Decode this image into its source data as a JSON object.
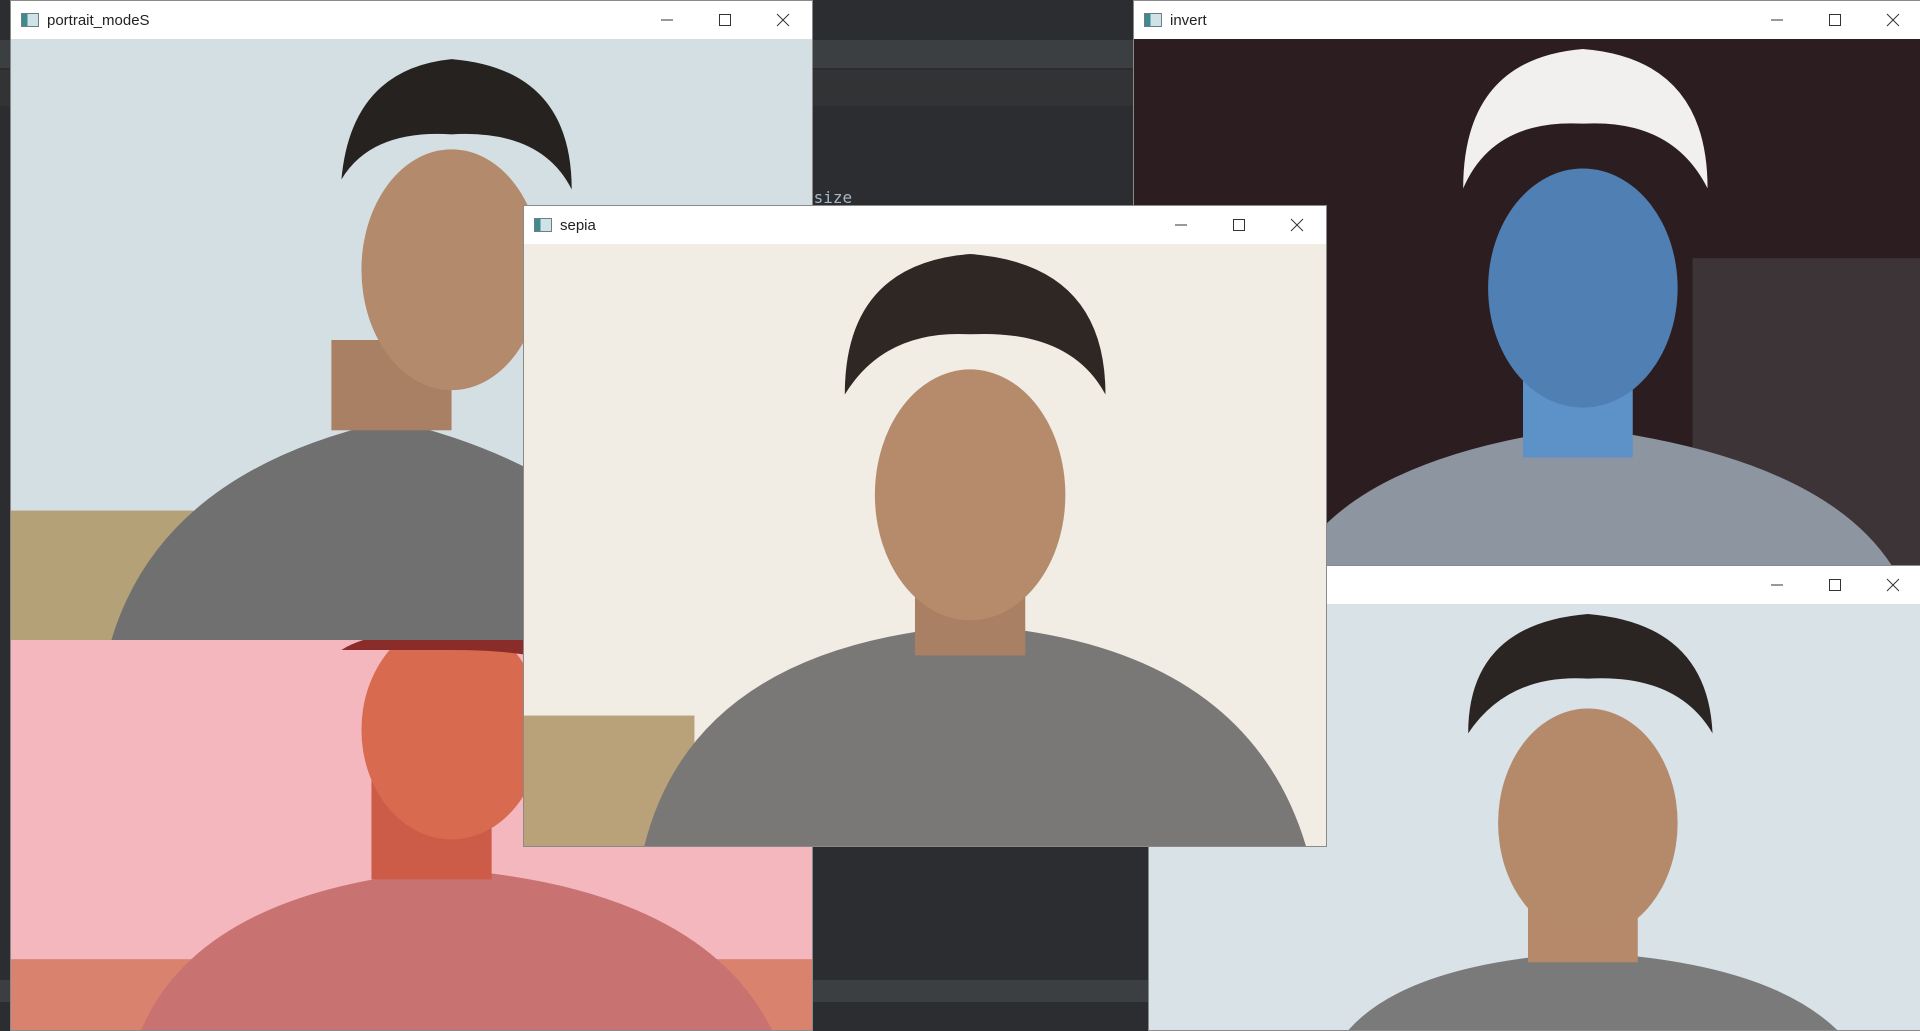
{
  "ide": {
    "code_fragment": "esize"
  },
  "windows": {
    "portrait": {
      "title": "portrait_modeS",
      "icon": "opencv-window-icon"
    },
    "invert": {
      "title": "invert",
      "icon": "opencv-window-icon"
    },
    "sepia": {
      "title": "sepia",
      "icon": "opencv-window-icon"
    },
    "blur_br": {
      "title": ""
    },
    "red_tint": {
      "title": ""
    }
  },
  "colors": {
    "sepia_bg": "#f1ece4",
    "portrait_bg": "#d7e2e6",
    "invert_bg": "#2a1d1f",
    "red_bg": "#f7b9bf",
    "blur_bg": "#d9e3e8",
    "shirt": "#747474",
    "hair": "#2b2624",
    "skin": "#b98c6c"
  }
}
